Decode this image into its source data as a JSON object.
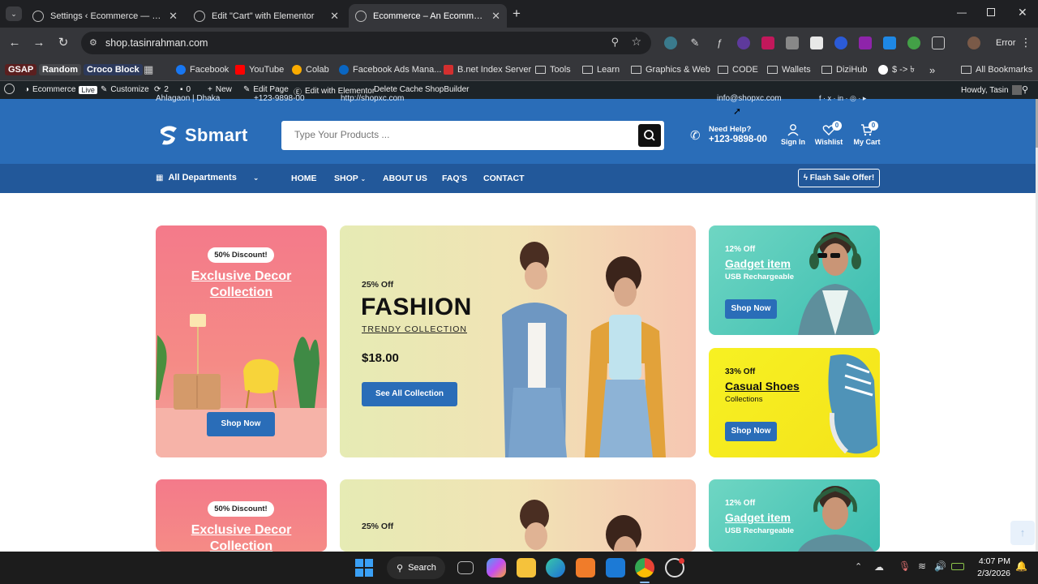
{
  "browser": {
    "tabs": [
      {
        "title": "Settings ‹ Ecommerce — WordPress"
      },
      {
        "title": "Edit \"Cart\" with Elementor"
      },
      {
        "title": "Ecommerce – An Ecommerce Website"
      }
    ],
    "url": "shop.tasinrahman.com",
    "error_label": "Error",
    "bookmarks": [
      "GSAP",
      "Random",
      "Croco Block",
      "Facebook",
      "YouTube",
      "Colab",
      "Facebook Ads Mana...",
      "B.net Index Server",
      "Tools",
      "Learn",
      "Graphics & Web",
      "CODE",
      "Wallets",
      "DiziHub",
      "$ -> ৳"
    ],
    "all_bookmarks": "All Bookmarks"
  },
  "wpbar": {
    "site": "Ecommerce",
    "live": "Live",
    "customize": "Customize",
    "updates": "2",
    "comments": "0",
    "new": "New",
    "edit_page": "Edit Page",
    "edit_elementor": "Edit with Elementor",
    "delete_cache": "Delete Cache",
    "shopbuilder": "ShopBuilder",
    "howdy": "Howdy, Tasin"
  },
  "header": {
    "top_left": "Ahlagaon | Dhaka",
    "top_phone": "+123-9898-00",
    "top_site": "http://shopxc.com",
    "top_email": "info@shopxc.com",
    "logo": "Sbmart",
    "search_placeholder": "Type Your Products ...",
    "help_label": "Need Help?",
    "help_phone": "+123-9898-00",
    "signin": "Sign In",
    "wishlist": "Wishlist",
    "wishlist_count": "0",
    "cart": "My Cart",
    "cart_count": "0"
  },
  "nav": {
    "departments": "All Departments",
    "links": [
      "HOME",
      "SHOP",
      "ABOUT US",
      "FAQ'S",
      "CONTACT"
    ],
    "flash": "Flash Sale Offer!"
  },
  "banners": {
    "decor": {
      "badge": "50% Discount!",
      "title": "Exclusive Decor Collection",
      "button": "Shop Now"
    },
    "fashion": {
      "off": "25% Off",
      "title": "FASHION",
      "subtitle": "TRENDY COLLECTION",
      "price": "$18.00",
      "button": "See All Collection"
    },
    "gadget": {
      "off": "12% Off",
      "title": "Gadget item",
      "subtitle": "USB Rechargeable",
      "button": "Shop Now"
    },
    "shoes": {
      "off": "33% Off",
      "title": "Casual Shoes",
      "subtitle": "Collections",
      "button": "Shop Now"
    }
  },
  "taskbar": {
    "search": "Search",
    "time": "4:07 PM",
    "date": "2/3/2026"
  }
}
